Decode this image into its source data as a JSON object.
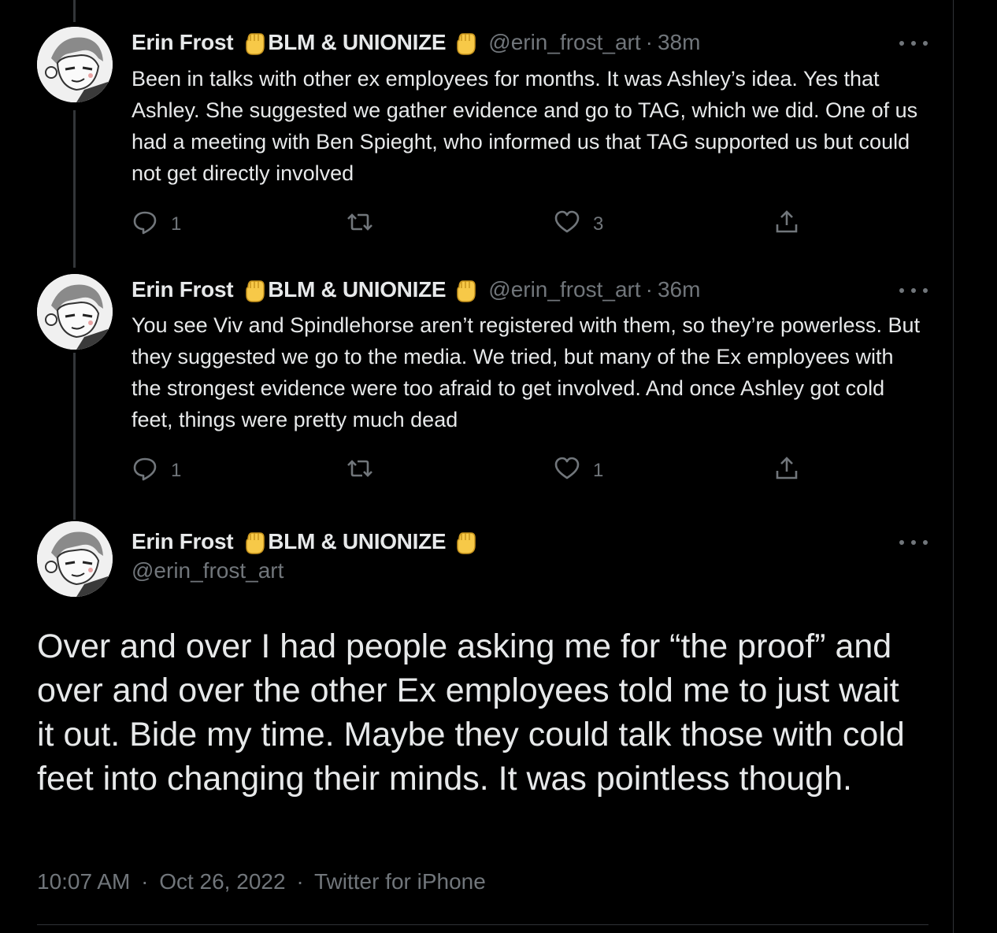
{
  "colors": {
    "background": "#000000",
    "text_primary": "#e7e9ea",
    "text_secondary": "#71767b",
    "divider": "#2f3336",
    "emoji_fist": "#f7c948"
  },
  "icons": {
    "reply": "reply-icon",
    "retweet": "retweet-icon",
    "like": "heart-icon",
    "share": "share-icon",
    "more": "more-icon",
    "emoji": "raised-fist-icon"
  },
  "tweets": [
    {
      "name_part1": "Erin Frost",
      "name_part2": "BLM & UNIONIZE",
      "handle": "@erin_frost_art",
      "separator": "·",
      "time": "38m",
      "text": "Been in talks with other ex employees for months. It was Ashley’s idea. Yes that Ashley. She suggested we gather evidence and go to TAG, which we did. One of us had a meeting with Ben Spieght, who informed us that TAG supported us but could not get directly involved",
      "reply_count": "1",
      "retweet_count": "",
      "like_count": "3"
    },
    {
      "name_part1": "Erin Frost",
      "name_part2": "BLM & UNIONIZE",
      "handle": "@erin_frost_art",
      "separator": "·",
      "time": "36m",
      "text": "You see Viv and Spindlehorse aren’t registered with them, so they’re powerless. But they suggested we go to the media. We tried, but many of the Ex employees with the strongest evidence were too afraid to get involved. And once Ashley got cold feet, things were pretty much dead",
      "reply_count": "1",
      "retweet_count": "",
      "like_count": "1"
    }
  ],
  "main_tweet": {
    "name_part1": "Erin Frost",
    "name_part2": "BLM & UNIONIZE",
    "handle": "@erin_frost_art",
    "text": "Over and over I had people asking me for “the proof” and over and over the other Ex employees told me to just wait it out. Bide my time. Maybe they could talk those with cold feet into changing their minds. It was pointless though.",
    "time": "10:07 AM",
    "separator": "·",
    "date": "Oct 26, 2022",
    "source": "Twitter for iPhone"
  }
}
